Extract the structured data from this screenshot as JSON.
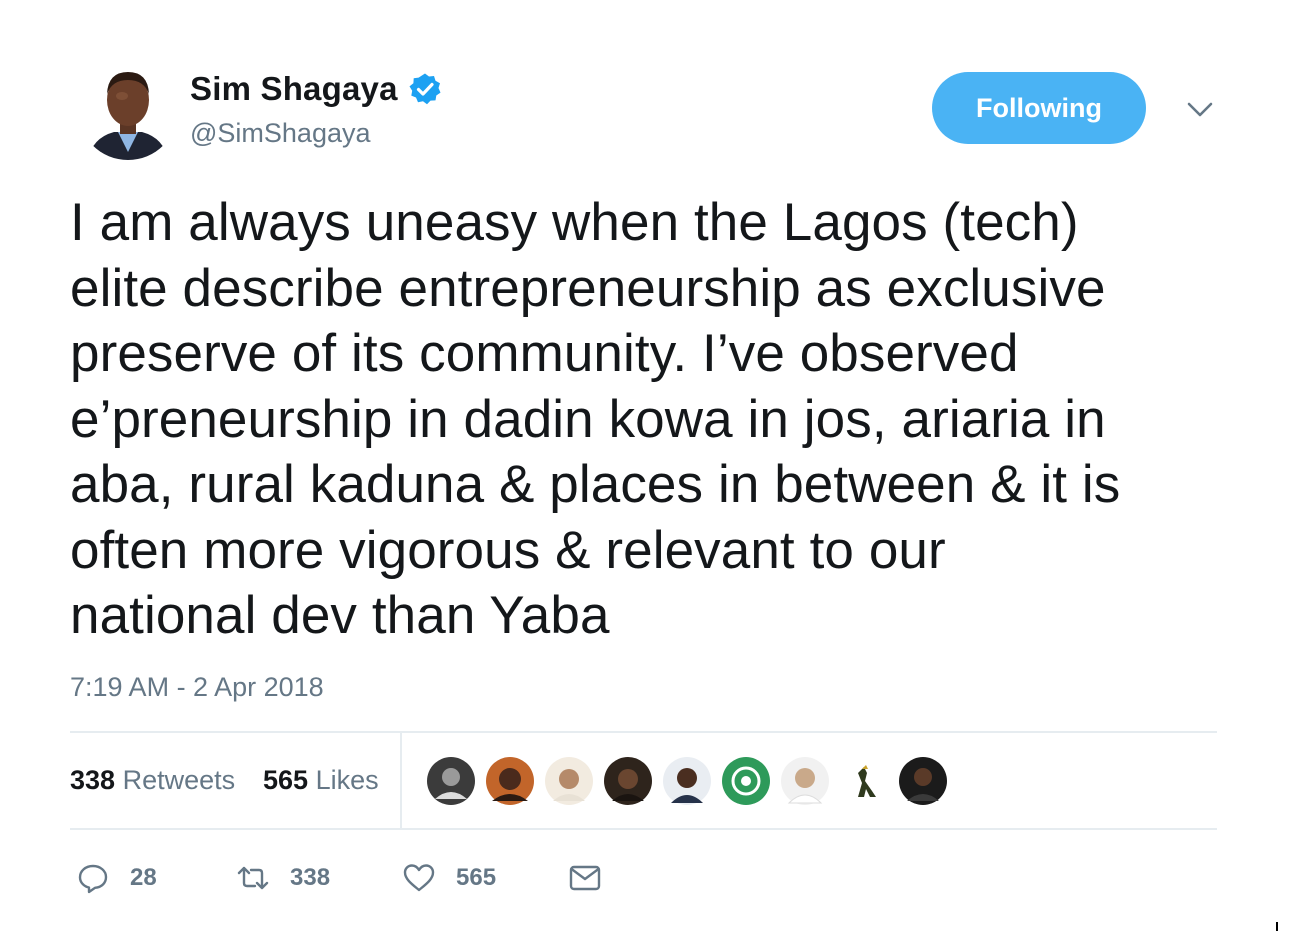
{
  "user": {
    "display_name": "Sim Shagaya",
    "handle": "@SimShagaya",
    "verified_icon": "verified-badge-icon",
    "avatar_icon": "avatar"
  },
  "follow_button": {
    "label": "Following"
  },
  "menu_icon": "chevron-down-icon",
  "tweet": {
    "text": "I am always uneasy when the Lagos (tech)\nelite describe entrepreneurship as exclusive\npreserve of its community. I’ve observed\ne’preneurship in dadin kowa in jos, ariaria in\naba, rural kaduna & places in between & it is\noften more vigorous & relevant to our\nnational dev than Yaba",
    "timestamp": "7:19 AM - 2 Apr 2018"
  },
  "stats": {
    "retweets_count": "338",
    "retweets_label": "Retweets",
    "likes_count": "565",
    "likes_label": "Likes",
    "liker_avatar_count": 9
  },
  "actions": {
    "reply_count": "28",
    "retweet_count": "338",
    "like_count": "565",
    "reply_icon": "reply-icon",
    "retweet_icon": "retweet-icon",
    "like_icon": "heart-icon",
    "message_icon": "envelope-icon"
  },
  "colors": {
    "accent": "#4ab3f4",
    "verified": "#1da1f2",
    "text": "#14171a",
    "muted": "#657786",
    "divider": "#e6ecf0"
  }
}
